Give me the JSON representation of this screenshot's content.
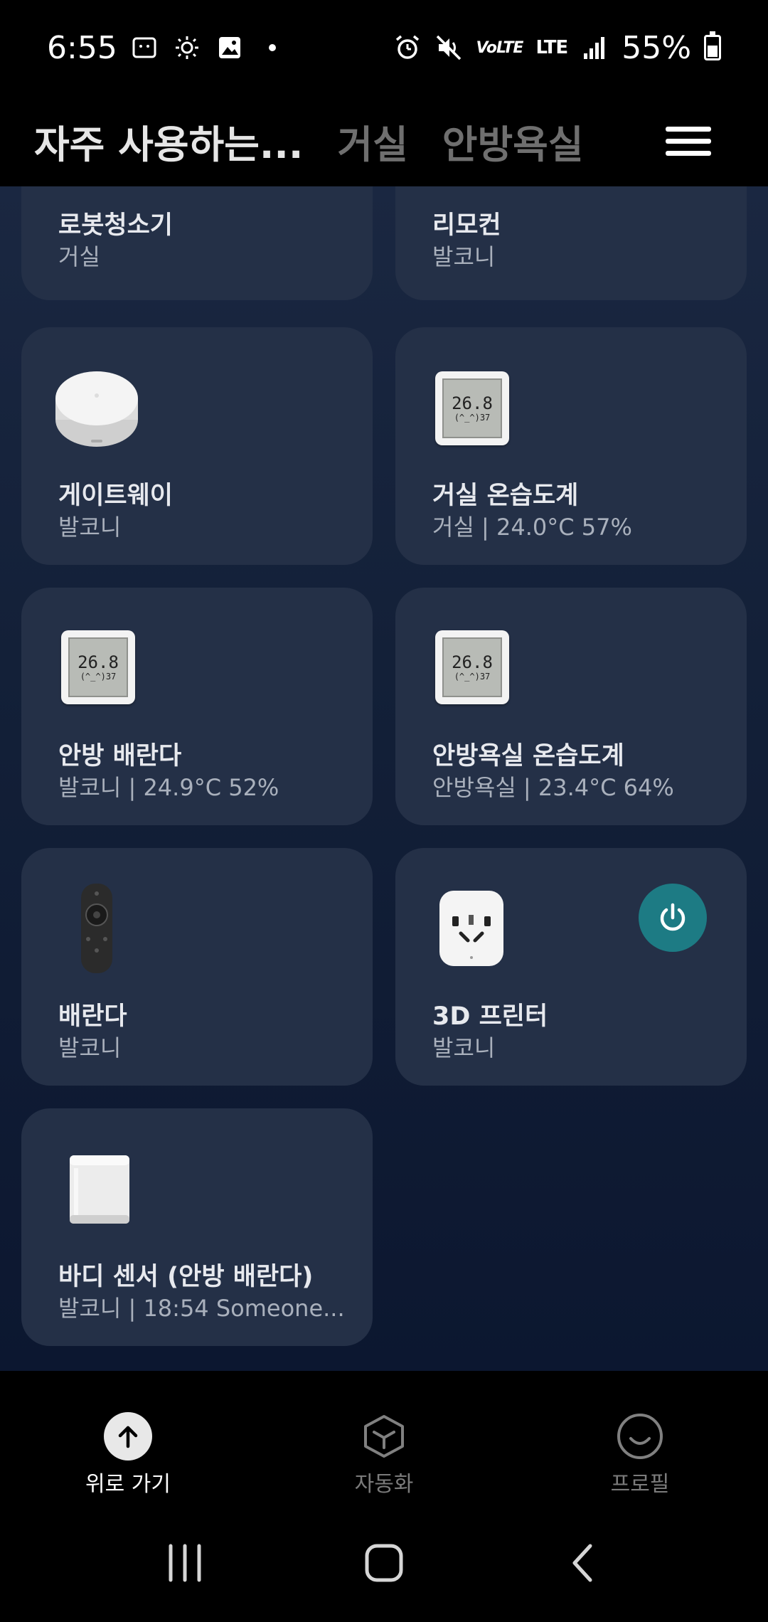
{
  "status_bar": {
    "time": "6:55",
    "battery_percent": "55%",
    "network_text": "LTE",
    "volte_text": "VoLTE"
  },
  "header": {
    "tabs": [
      {
        "label": "자주 사용하는..."
      },
      {
        "label": "거실"
      },
      {
        "label": "안방욕실"
      }
    ]
  },
  "devices": [
    {
      "name": "로봇청소기",
      "room": "거실",
      "icon": "robot-vacuum-icon"
    },
    {
      "name": "리모컨",
      "room": "발코니",
      "icon": "remote-icon"
    },
    {
      "name": "게이트웨이",
      "room": "발코니",
      "icon": "gateway-icon"
    },
    {
      "name": "거실 온습도계",
      "room": "거실 | 24.0°C 57%",
      "icon": "thermometer-icon"
    },
    {
      "name": "안방 배란다",
      "room": "발코니 | 24.9°C 52%",
      "icon": "thermometer-icon"
    },
    {
      "name": "안방욕실 온습도계",
      "room": "안방욕실 | 23.4°C 64%",
      "icon": "thermometer-icon"
    },
    {
      "name": "배란다",
      "room": "발코니",
      "icon": "speaker-remote-icon"
    },
    {
      "name": "3D 프린터",
      "room": "발코니",
      "icon": "smart-plug-icon"
    },
    {
      "name": "바디 센서 (안방 배란다)",
      "room": "발코니 | 18:54 Someone...",
      "icon": "motion-sensor-icon"
    }
  ],
  "thermo_display": {
    "top": "26.8",
    "bottom": "(^_^)37"
  },
  "bottom_nav": [
    {
      "label": "위로 가기",
      "icon": "arrow-up-icon"
    },
    {
      "label": "자동화",
      "icon": "cube-icon"
    },
    {
      "label": "프로필",
      "icon": "smile-icon"
    }
  ],
  "colors": {
    "background_top": "#1a2741",
    "card": "#243047",
    "power_accent": "#1d7b84"
  }
}
